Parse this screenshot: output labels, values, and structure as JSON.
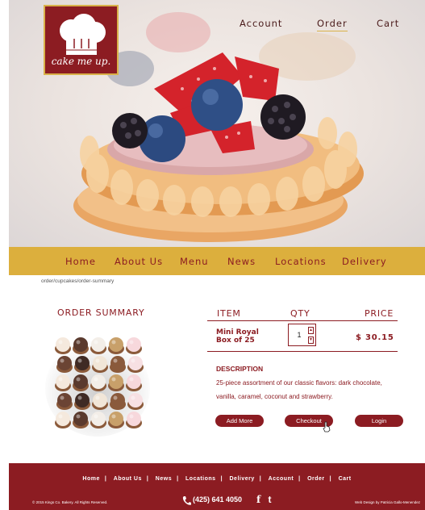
{
  "brand": {
    "logo_text": "cake me up."
  },
  "top_nav": {
    "account": "Account",
    "order": "Order",
    "cart": "Cart"
  },
  "main_nav": [
    "Home",
    "About Us",
    "Menu",
    "News",
    "Locations",
    "Delivery"
  ],
  "breadcrumb": "order/cupcakes/order-summary",
  "summary": {
    "title": "ORDER SUMMARY"
  },
  "order_table": {
    "headers": {
      "item": "ITEM",
      "qty": "QTY",
      "price": "PRICE"
    },
    "row": {
      "name_line1": "Mini Royal",
      "name_line2": "Box of 25",
      "qty": "1",
      "price": "$ 30.15"
    }
  },
  "description": {
    "title": "DESCRIPTION",
    "text": "25-piece assortment of our classic flavors: dark chocolate, vanilla, caramel, coconut and strawberry."
  },
  "buttons": {
    "add_more": "Add More",
    "checkout": "Checkout",
    "login": "Login"
  },
  "footer": {
    "links": [
      "Home",
      "About Us",
      "News",
      "Locations",
      "Delivery",
      "Account",
      "Order",
      "Cart"
    ],
    "separator": "|",
    "copyright": "© 2015 Kings Co. Bakery. All Rights Reserved.",
    "phone": "(425) 641 4050",
    "social": {
      "facebook": "f",
      "twitter": "t"
    },
    "credit": "Web Design by Patricia Gallo-Menendez"
  },
  "colors": {
    "maroon": "#8c1c22",
    "gold": "#dcaf3d",
    "white": "#ffffff"
  }
}
